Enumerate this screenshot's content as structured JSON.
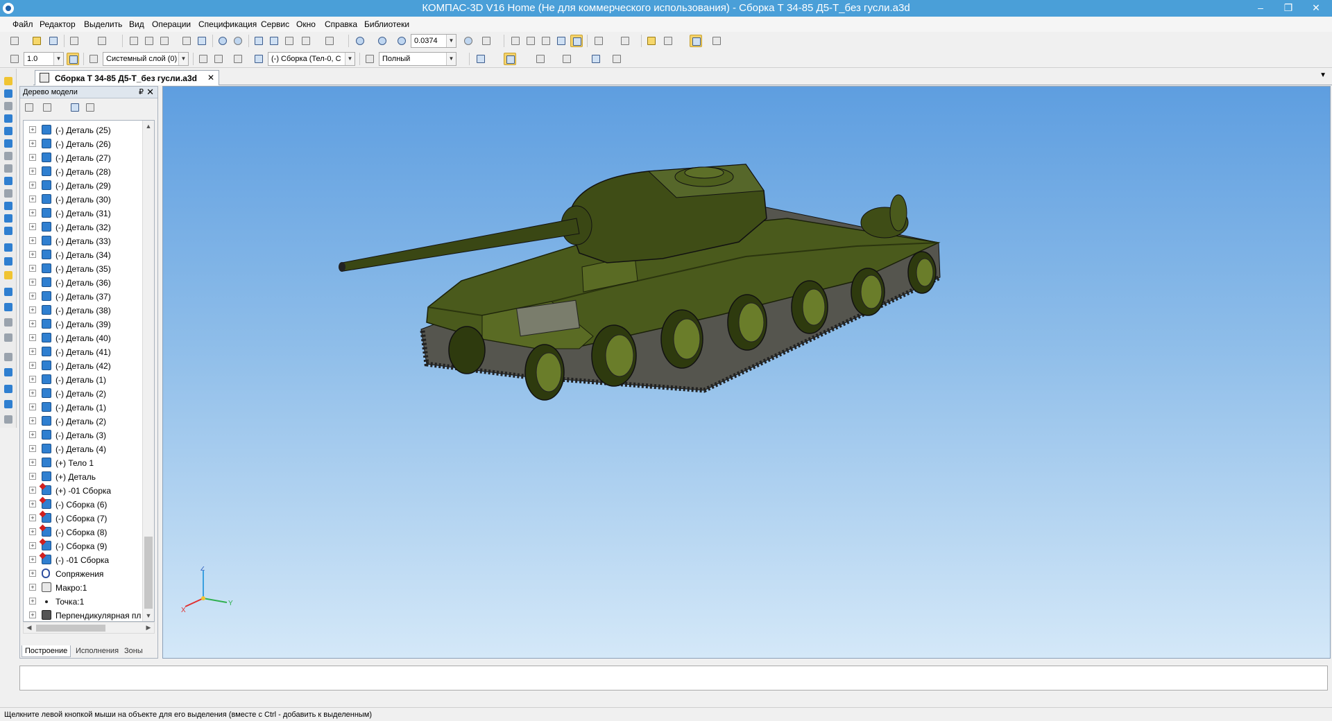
{
  "window": {
    "title": "КОМПАС-3D V16 Home  (Не для коммерческого использования) - Сборка Т 34-85 Д5-Т_без гусли.a3d",
    "minimize": "‒",
    "maximize": "❐",
    "close": "✕"
  },
  "menu": [
    "Файл",
    "Редактор",
    "Выделить",
    "Вид",
    "Операции",
    "Спецификация",
    "Сервис",
    "Окно",
    "Справка",
    "Библиотеки"
  ],
  "toolbar": {
    "zoom_value": "0.0374",
    "step_value": "1.0",
    "layer": "Системный слой (0)",
    "body_filter": "(-) Сборка (Тел-0, С",
    "render_mode": "Полный"
  },
  "document_tab": {
    "label": "Сборка Т 34-85 Д5-Т_без гусли.a3d",
    "close": "✕",
    "menu_arrow": "▼"
  },
  "tree": {
    "title": "Дерево модели",
    "pin": "₽",
    "close": "✕",
    "items": [
      {
        "label": "(-) Деталь (25)",
        "icon": "part-icon"
      },
      {
        "label": "(-) Деталь (26)",
        "icon": "part-icon"
      },
      {
        "label": "(-) Деталь (27)",
        "icon": "part-icon"
      },
      {
        "label": "(-) Деталь (28)",
        "icon": "part-icon"
      },
      {
        "label": "(-) Деталь (29)",
        "icon": "part-icon"
      },
      {
        "label": "(-) Деталь (30)",
        "icon": "part-icon"
      },
      {
        "label": "(-) Деталь (31)",
        "icon": "part-icon"
      },
      {
        "label": "(-) Деталь (32)",
        "icon": "part-icon"
      },
      {
        "label": "(-) Деталь (33)",
        "icon": "part-icon"
      },
      {
        "label": "(-) Деталь (34)",
        "icon": "part-icon"
      },
      {
        "label": "(-) Деталь (35)",
        "icon": "part-icon"
      },
      {
        "label": "(-) Деталь (36)",
        "icon": "part-icon"
      },
      {
        "label": "(-) Деталь (37)",
        "icon": "part-icon"
      },
      {
        "label": "(-) Деталь (38)",
        "icon": "part-icon"
      },
      {
        "label": "(-) Деталь (39)",
        "icon": "part-icon"
      },
      {
        "label": "(-) Деталь (40)",
        "icon": "part-icon"
      },
      {
        "label": "(-) Деталь (41)",
        "icon": "part-icon"
      },
      {
        "label": "(-) Деталь (42)",
        "icon": "part-icon"
      },
      {
        "label": "(-) Деталь (1)",
        "icon": "part-icon"
      },
      {
        "label": "(-) Деталь (2)",
        "icon": "part-icon"
      },
      {
        "label": "(-) Деталь (1)",
        "icon": "part-icon"
      },
      {
        "label": "(-) Деталь (2)",
        "icon": "part-icon"
      },
      {
        "label": "(-) Деталь (3)",
        "icon": "part-icon"
      },
      {
        "label": "(-) Деталь (4)",
        "icon": "part-icon"
      },
      {
        "label": "(+) Тело 1",
        "icon": "part-icon"
      },
      {
        "label": "(+) Деталь",
        "icon": "part-icon"
      },
      {
        "label": "(+) -01 Сборка",
        "icon": "assembly-icon"
      },
      {
        "label": "(-) Сборка (6)",
        "icon": "assembly-icon"
      },
      {
        "label": "(-) Сборка (7)",
        "icon": "assembly-icon"
      },
      {
        "label": "(-) Сборка (8)",
        "icon": "assembly-icon"
      },
      {
        "label": "(-) Сборка (9)",
        "icon": "assembly-icon"
      },
      {
        "label": "(-) -01 Сборка",
        "icon": "assembly-icon"
      },
      {
        "label": "Сопряжения",
        "icon": "mates-icon"
      },
      {
        "label": "Макро:1",
        "icon": "macro-icon"
      },
      {
        "label": "Точка:1",
        "icon": "point-icon"
      },
      {
        "label": "Перпендикулярная пл",
        "icon": "plane-icon"
      }
    ],
    "tabs": [
      "Построение",
      "Исполнения",
      "Зоны"
    ]
  },
  "viewport": {
    "axis_z": "Z",
    "axis_x": "X",
    "axis_y": "Y",
    "colors": {
      "tank_body": "#4a5a1c",
      "tank_shadow": "#2b350e",
      "track": "#6b6b62",
      "sky_top": "#5e9ee0",
      "sky_bottom": "#d4e8f8"
    }
  },
  "status": {
    "hint": "Щелкните левой кнопкой мыши на объекте для его выделения (вместе с Ctrl - добавить к выделенным)"
  }
}
